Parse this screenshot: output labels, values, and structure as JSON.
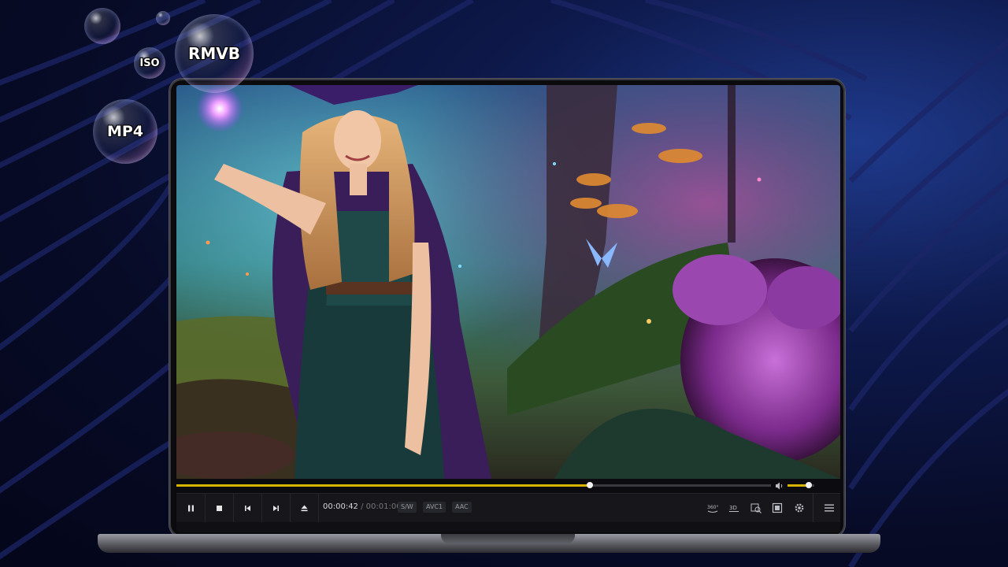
{
  "bubbles": {
    "rmvb": "RMVB",
    "iso": "ISO",
    "mp4": "MP4"
  },
  "player": {
    "progress_fraction": 0.695,
    "volume_fraction": 0.78,
    "time_current": "00:00:42",
    "time_separator": "/",
    "time_total": "00:01:00",
    "tags": [
      "S/W",
      "AVC1",
      "AAC"
    ],
    "buttons": [
      "pause-icon",
      "stop-icon",
      "previous-icon",
      "next-icon",
      "eject-icon"
    ],
    "right_icons": [
      "360-icon",
      "3d-icon",
      "snapshot-icon",
      "subtitle-icon",
      "settings-icon",
      "menu-icon"
    ],
    "right_icon_labels": {
      "vr": "360°",
      "threed": "3D"
    },
    "accent_color": "#d6b400"
  }
}
